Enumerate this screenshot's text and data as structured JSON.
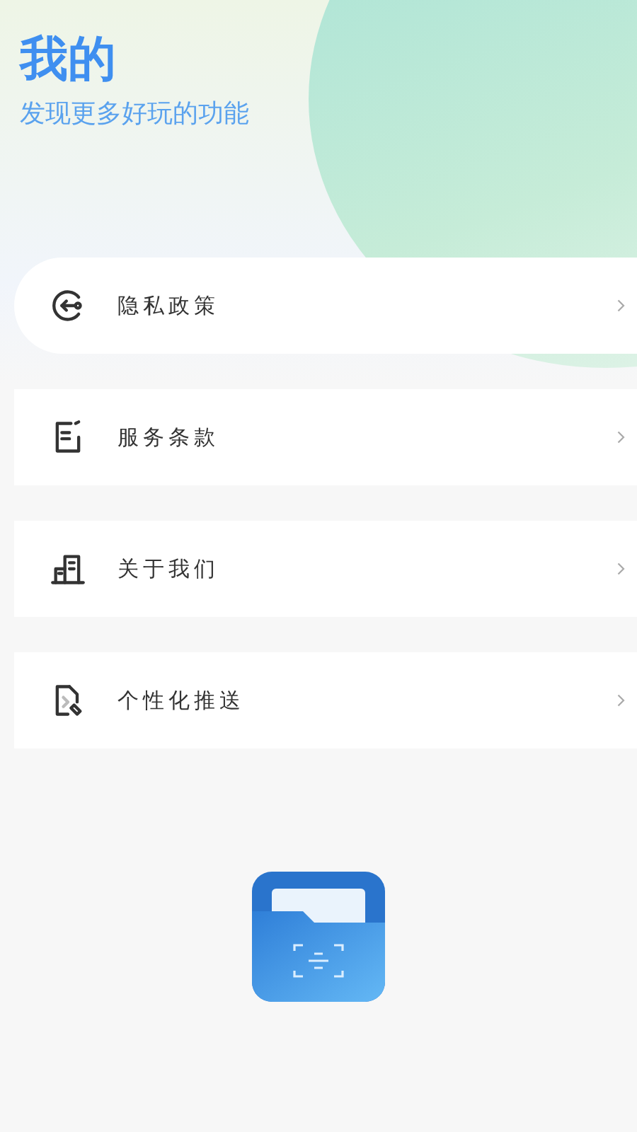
{
  "header": {
    "title": "我的",
    "subtitle": "发现更多好玩的功能"
  },
  "menu": [
    {
      "label": "隐私政策",
      "kind": "rounded"
    },
    {
      "label": "服务条款",
      "kind": "flat"
    },
    {
      "label": "关于我们",
      "kind": "flat"
    },
    {
      "label": "个性化推送",
      "kind": "flat"
    }
  ]
}
